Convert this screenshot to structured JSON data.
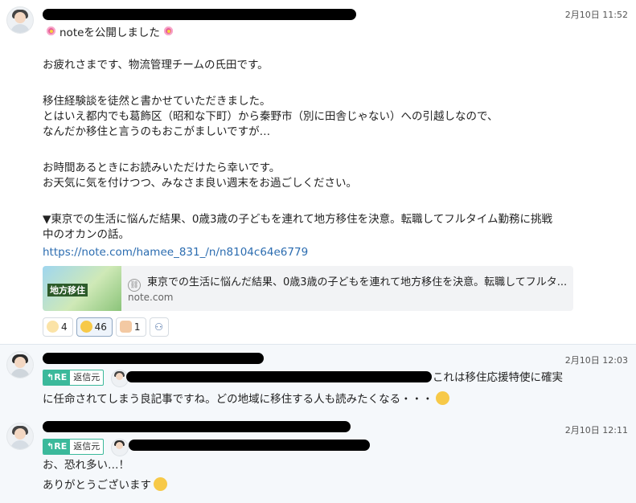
{
  "messages": [
    {
      "time": "2月10日 11:52",
      "lines": [
        "noteを公開しました",
        "お疲れさまです、物流管理チームの氏田です。",
        "移住経験談を徒然と書かせていただきました。",
        "とはいえ都内でも葛飾区（昭和な下町）から秦野市（別に田舎じゃない）への引越しなので、",
        "なんだか移住と言うのもおこがましいですが…",
        "お時間あるときにお読みいただけたら幸いです。",
        "お天気に気を付けつつ、みなさま良い週末をお過ごしください。",
        "▼東京での生活に悩んだ結果、0歳3歳の子どもを連れて地方移住を決意。転職してフルタイム勤務に挑戦",
        "中のオカンの話。"
      ],
      "link": "https://note.com/hamee_831_/n/n8104c64e6779",
      "preview": {
        "title": "東京での生活に悩んだ結果、0歳3歳の子どもを連れて地方移住を決意。転職してフルタ...",
        "domain": "note.com",
        "thumb_label": "地方移住"
      },
      "reactions": [
        {
          "icon": "party-popper-icon",
          "count": "4"
        },
        {
          "icon": "cry-face-icon",
          "count": "46"
        },
        {
          "icon": "thumbs-up-icon",
          "count": "1"
        }
      ]
    },
    {
      "time": "2月10日 12:03",
      "re_label": "RE",
      "reply_label": "返信元",
      "lines": [
        "これは移住応援特使に確実",
        "に任命されてしまう良記事ですね。どの地域に移住する人も読みたくなる・・・"
      ]
    },
    {
      "time": "2月10日 12:11",
      "re_label": "RE",
      "reply_label": "返信元",
      "lines": [
        "お、恐れ多い…！",
        "ありがとうございます"
      ]
    }
  ]
}
